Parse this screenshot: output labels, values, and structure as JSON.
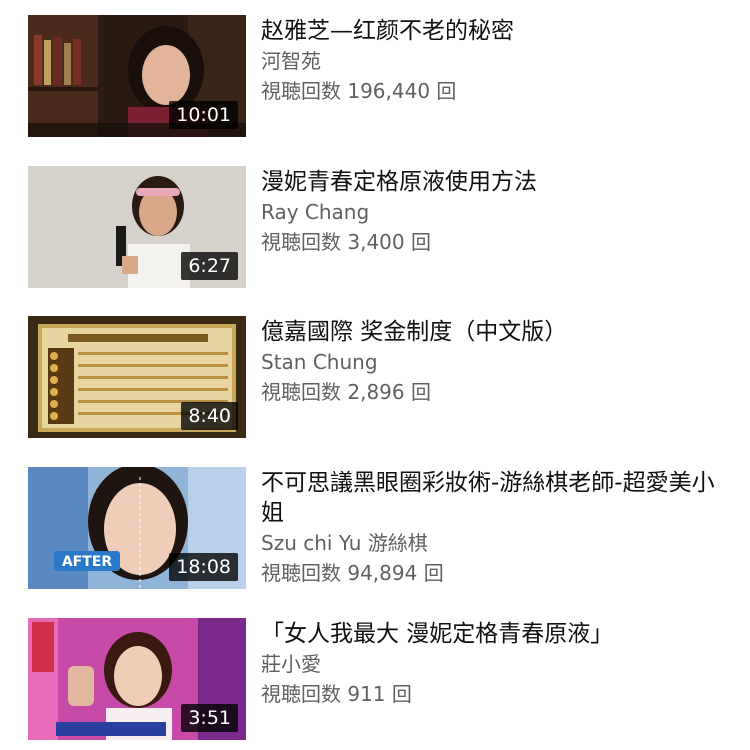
{
  "videos": [
    {
      "title": "赵雅芝—红颜不老的秘密",
      "channel": "河智苑",
      "views": "視聴回数 196,440 回",
      "duration": "10:01"
    },
    {
      "title": "漫妮青春定格原液使用方法",
      "channel": "Ray Chang",
      "views": "視聴回数 3,400 回",
      "duration": "6:27"
    },
    {
      "title": "億嘉國際 奖金制度（中文版）",
      "channel": "Stan Chung",
      "views": "視聴回数 2,896 回",
      "duration": "8:40"
    },
    {
      "title": "不可思議黑眼圈彩妝術-游絲棋老師-超愛美小姐",
      "channel": "Szu chi Yu 游絲棋",
      "views": "視聴回数 94,894 回",
      "duration": "18:08",
      "thumb_badge": "AFTER"
    },
    {
      "title": "「女人我最大 漫妮定格青春原液」",
      "channel": "莊小愛",
      "views": "視聴回数 911 回",
      "duration": "3:51"
    }
  ],
  "colors": {
    "title": "#111111",
    "secondary": "#606060",
    "duration_bg": "#000000"
  }
}
